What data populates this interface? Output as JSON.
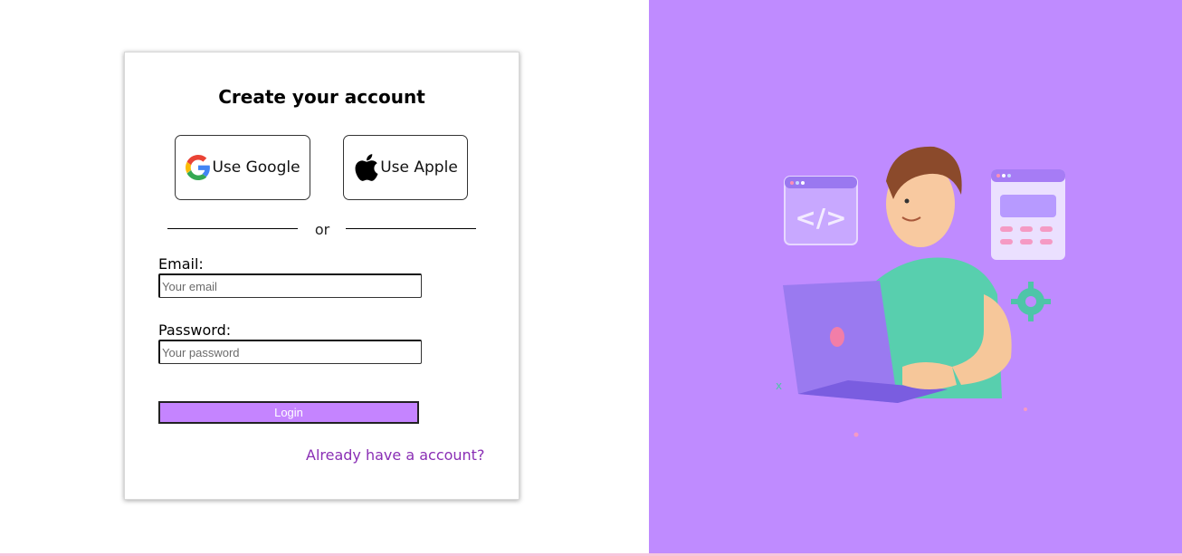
{
  "signup": {
    "title": "Create your account",
    "google_label": "Use Google",
    "apple_label": "Use Apple",
    "divider": "or",
    "email_label": "Email:",
    "email_placeholder": "Your email",
    "email_value": "",
    "password_label": "Password:",
    "password_placeholder": "Your password",
    "password_value": "",
    "login_label": "Login",
    "signin_link": "Already have a account?"
  },
  "colors": {
    "accent": "#c584ff",
    "right_panel": "#bf8bff",
    "link": "#8a2fb5"
  },
  "icons": {
    "google": "google-logo-icon",
    "apple": "apple-logo-icon"
  }
}
